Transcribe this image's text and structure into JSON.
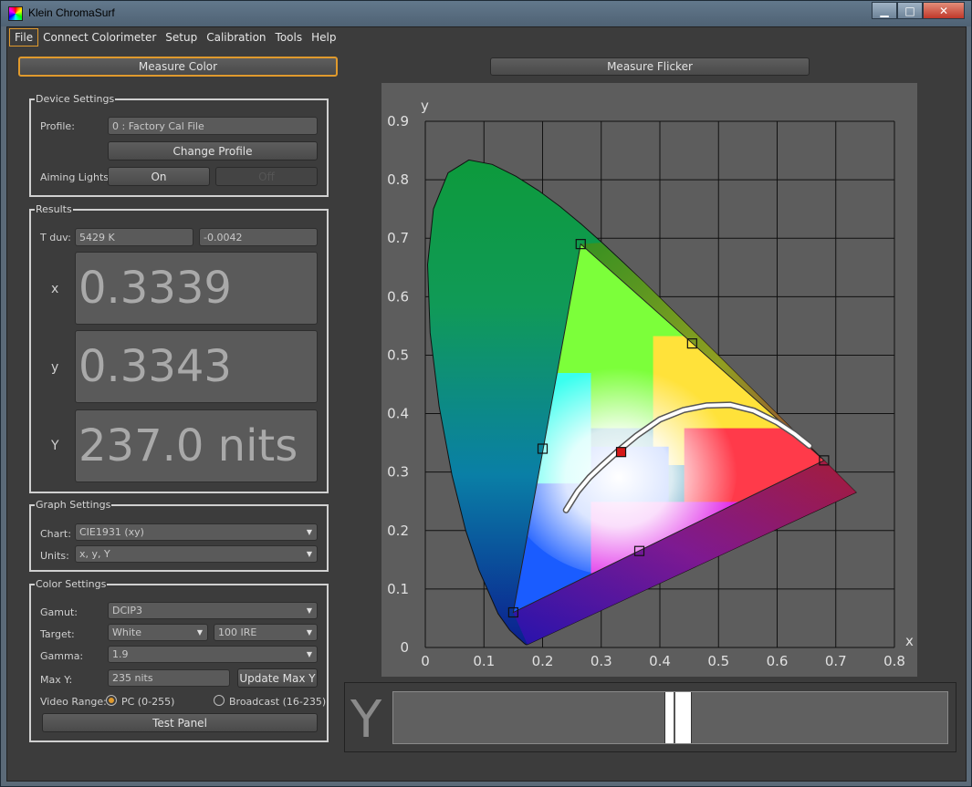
{
  "window": {
    "title": "Klein ChromaSurf",
    "controls": {
      "minimize": "▁",
      "maximize": "□",
      "close": "✕"
    }
  },
  "menu": [
    "File",
    "Connect Colorimeter",
    "Setup",
    "Calibration",
    "Tools",
    "Help"
  ],
  "top_buttons": {
    "measure_color": "Measure Color",
    "measure_flicker": "Measure Flicker"
  },
  "device_settings": {
    "title": "Device Settings",
    "profile_label": "Profile:",
    "profile_value": "0 : Factory Cal File",
    "change_profile": "Change Profile",
    "aiming_label": "Aiming Lights:",
    "on": "On",
    "off": "Off"
  },
  "results": {
    "title": "Results",
    "tduv_label": "T duv:",
    "t_value": "5429 K",
    "duv_value": "-0.0042",
    "x_label": "x",
    "x_value": "0.3339",
    "y_label": "y",
    "y_value": "0.3343",
    "Y_label": "Y",
    "Y_value": "237.0 nits"
  },
  "graph_settings": {
    "title": "Graph Settings",
    "chart_label": "Chart:",
    "chart_value": "CIE1931 (xy)",
    "units_label": "Units:",
    "units_value": "x, y, Y"
  },
  "color_settings": {
    "title": "Color Settings",
    "gamut_label": "Gamut:",
    "gamut_value": "DCIP3",
    "target_label": "Target:",
    "target_value": "White",
    "ire_value": "100 IRE",
    "gamma_label": "Gamma:",
    "gamma_value": "1.9",
    "maxy_label": "Max Y:",
    "maxy_value": "235 nits",
    "update_maxy": "Update Max Y",
    "video_range_label": "Video Range:",
    "pc_range": "PC (0-255)",
    "broadcast_range": "Broadcast (16-235)",
    "test_panel": "Test Panel"
  },
  "y_bar": {
    "label": "Y",
    "level_fraction": 0.49,
    "target_fraction": 0.485
  },
  "colors": {
    "accent": "#e09a2d",
    "panel_bg": "#3c3c3c",
    "field_bg": "#5a5a5a",
    "plot_bg": "#5d5d5d"
  },
  "chart_data": {
    "type": "scatter",
    "title": "",
    "xlabel": "x",
    "ylabel": "y",
    "xlim": [
      0,
      0.8
    ],
    "ylim": [
      0,
      0.9
    ],
    "x_ticks": [
      "0",
      "0.1",
      "0.2",
      "0.3",
      "0.4",
      "0.5",
      "0.6",
      "0.7",
      "0.8"
    ],
    "y_ticks": [
      "0",
      "0.1",
      "0.2",
      "0.3",
      "0.4",
      "0.5",
      "0.6",
      "0.7",
      "0.8",
      "0.9"
    ],
    "grid": true,
    "gamut_triangle": [
      [
        0.265,
        0.69
      ],
      [
        0.68,
        0.32
      ],
      [
        0.15,
        0.06
      ]
    ],
    "gamut_secondary_points": [
      [
        0.455,
        0.52
      ],
      [
        0.2,
        0.34
      ],
      [
        0.365,
        0.165
      ]
    ],
    "measured_point": [
      0.3339,
      0.3343
    ],
    "planckian_locus": [
      [
        0.24,
        0.235
      ],
      [
        0.26,
        0.267
      ],
      [
        0.28,
        0.291
      ],
      [
        0.3,
        0.31
      ],
      [
        0.33,
        0.337
      ],
      [
        0.36,
        0.362
      ],
      [
        0.4,
        0.39
      ],
      [
        0.44,
        0.406
      ],
      [
        0.48,
        0.414
      ],
      [
        0.52,
        0.415
      ],
      [
        0.56,
        0.405
      ],
      [
        0.6,
        0.385
      ],
      [
        0.63,
        0.365
      ],
      [
        0.655,
        0.345
      ]
    ],
    "spectral_locus": [
      [
        0.1741,
        0.005
      ],
      [
        0.1733,
        0.0048
      ],
      [
        0.1726,
        0.0048
      ],
      [
        0.1714,
        0.0051
      ],
      [
        0.1689,
        0.0069
      ],
      [
        0.1644,
        0.0109
      ],
      [
        0.1566,
        0.0177
      ],
      [
        0.144,
        0.0297
      ],
      [
        0.1241,
        0.0578
      ],
      [
        0.0913,
        0.1327
      ],
      [
        0.0687,
        0.2007
      ],
      [
        0.0454,
        0.295
      ],
      [
        0.0235,
        0.4127
      ],
      [
        0.0082,
        0.5384
      ],
      [
        0.0039,
        0.6548
      ],
      [
        0.0139,
        0.7502
      ],
      [
        0.0389,
        0.812
      ],
      [
        0.0743,
        0.8338
      ],
      [
        0.1142,
        0.8262
      ],
      [
        0.1547,
        0.8059
      ],
      [
        0.1929,
        0.7816
      ],
      [
        0.2296,
        0.7543
      ],
      [
        0.2658,
        0.7243
      ],
      [
        0.3016,
        0.6923
      ],
      [
        0.3373,
        0.6589
      ],
      [
        0.3731,
        0.6245
      ],
      [
        0.4087,
        0.5896
      ],
      [
        0.4441,
        0.5547
      ],
      [
        0.4788,
        0.5202
      ],
      [
        0.5125,
        0.4866
      ],
      [
        0.5448,
        0.4544
      ],
      [
        0.5752,
        0.4242
      ],
      [
        0.6029,
        0.3965
      ],
      [
        0.627,
        0.3725
      ],
      [
        0.6482,
        0.3514
      ],
      [
        0.6658,
        0.334
      ],
      [
        0.6801,
        0.3197
      ],
      [
        0.6915,
        0.3083
      ],
      [
        0.7006,
        0.2993
      ],
      [
        0.714,
        0.2859
      ],
      [
        0.7347,
        0.2653
      ]
    ]
  }
}
